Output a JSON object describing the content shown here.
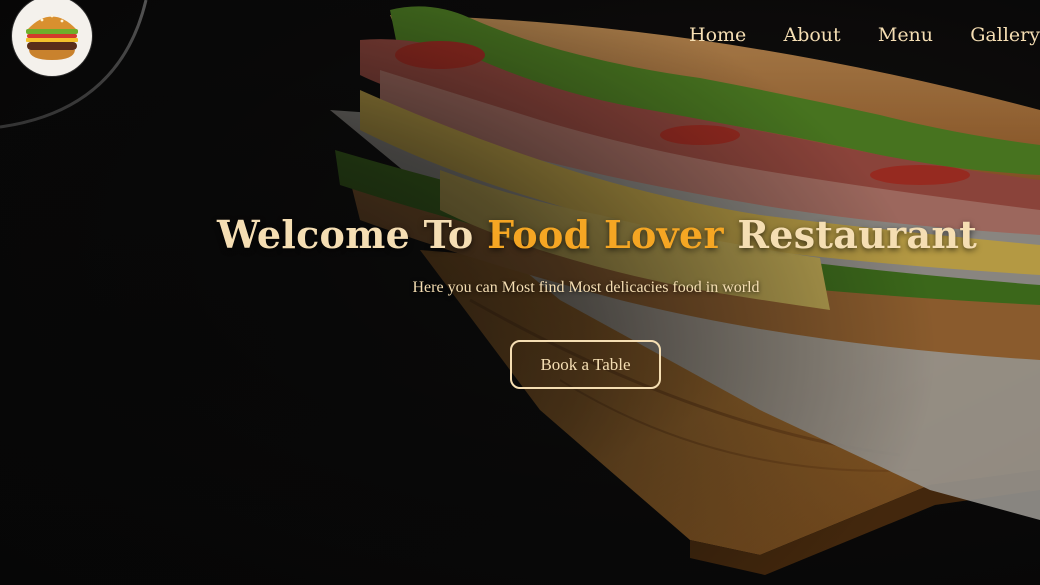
{
  "nav": {
    "items": [
      {
        "label": "Home"
      },
      {
        "label": "About"
      },
      {
        "label": "Menu"
      },
      {
        "label": "Gallery"
      }
    ]
  },
  "hero": {
    "title_part1": "Welcome To ",
    "title_accent": "Food Lover",
    "title_part2": " Restaurant",
    "subtitle": "Here you can Most find Most delicacies food in world",
    "cta_label": "Book a Table"
  },
  "colors": {
    "text": "#f5deb3",
    "accent": "#f5a623",
    "background": "#0c0c0c"
  },
  "icons": {
    "logo": "burger-logo-icon"
  }
}
